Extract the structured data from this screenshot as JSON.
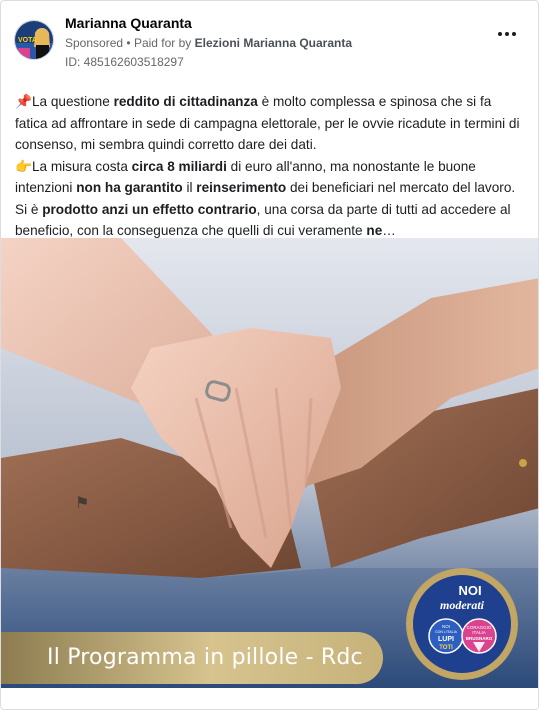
{
  "post": {
    "page_name": "Marianna Quaranta",
    "sponsored_label": "Sponsored",
    "paid_for_prefix": "Paid for by",
    "paid_for_by": "Elezioni Marianna Quaranta",
    "ad_id": "ID: 485162603518297"
  },
  "icons": {
    "more": "more-horizontal-icon",
    "pin": "pushpin-emoji",
    "hand": "pointing-right-emoji"
  },
  "body": {
    "p1_pin": "📌",
    "p1_a": "La questione ",
    "p1_b": "reddito di cittadinanza",
    "p1_c": " è molto complessa e spinosa che si fa fatica ad affrontare in sede di campagna elettorale, per le ovvie ricadute in termini di consenso, mi sembra quindi corretto dare dei dati.",
    "p2_hand": "👉",
    "p2_a": "La misura costa ",
    "p2_b": "circa 8 miliardi",
    "p2_c": " di euro all'anno, ma nonostante le buone intenzioni ",
    "p2_d": "non ha garantito",
    "p2_e": " il ",
    "p2_f": "reinserimento",
    "p2_g": " dei beneficiari nel mercato del lavoro. Si è ",
    "p2_h": "prodotto anzi un effetto contrario",
    "p2_i": ", una corsa da parte di tutti ad accedere al beneficio, con la conseguenza che quelli di cui veramente ",
    "p2_j": "ne",
    "p2_k": "…"
  },
  "media": {
    "banner_text": "Il Programma in pillole - Rdc",
    "logo_title_1": "NOI",
    "logo_title_2": "moderati",
    "logo_left_1": "NOI",
    "logo_left_2": "CON L'ITALIA",
    "logo_left_3": "LUPI",
    "logo_left_4": "TOTI",
    "logo_right_1": "CORAGGIO",
    "logo_right_2": "ITALIA",
    "logo_right_3": "BRUGNARO",
    "avatar_word": "VOTA"
  },
  "colors": {
    "banner_gold": "#c7b27a",
    "logo_blue": "#1f3f8f",
    "logo_pink": "#d9438f",
    "background_blue": "#2c4a7a"
  }
}
